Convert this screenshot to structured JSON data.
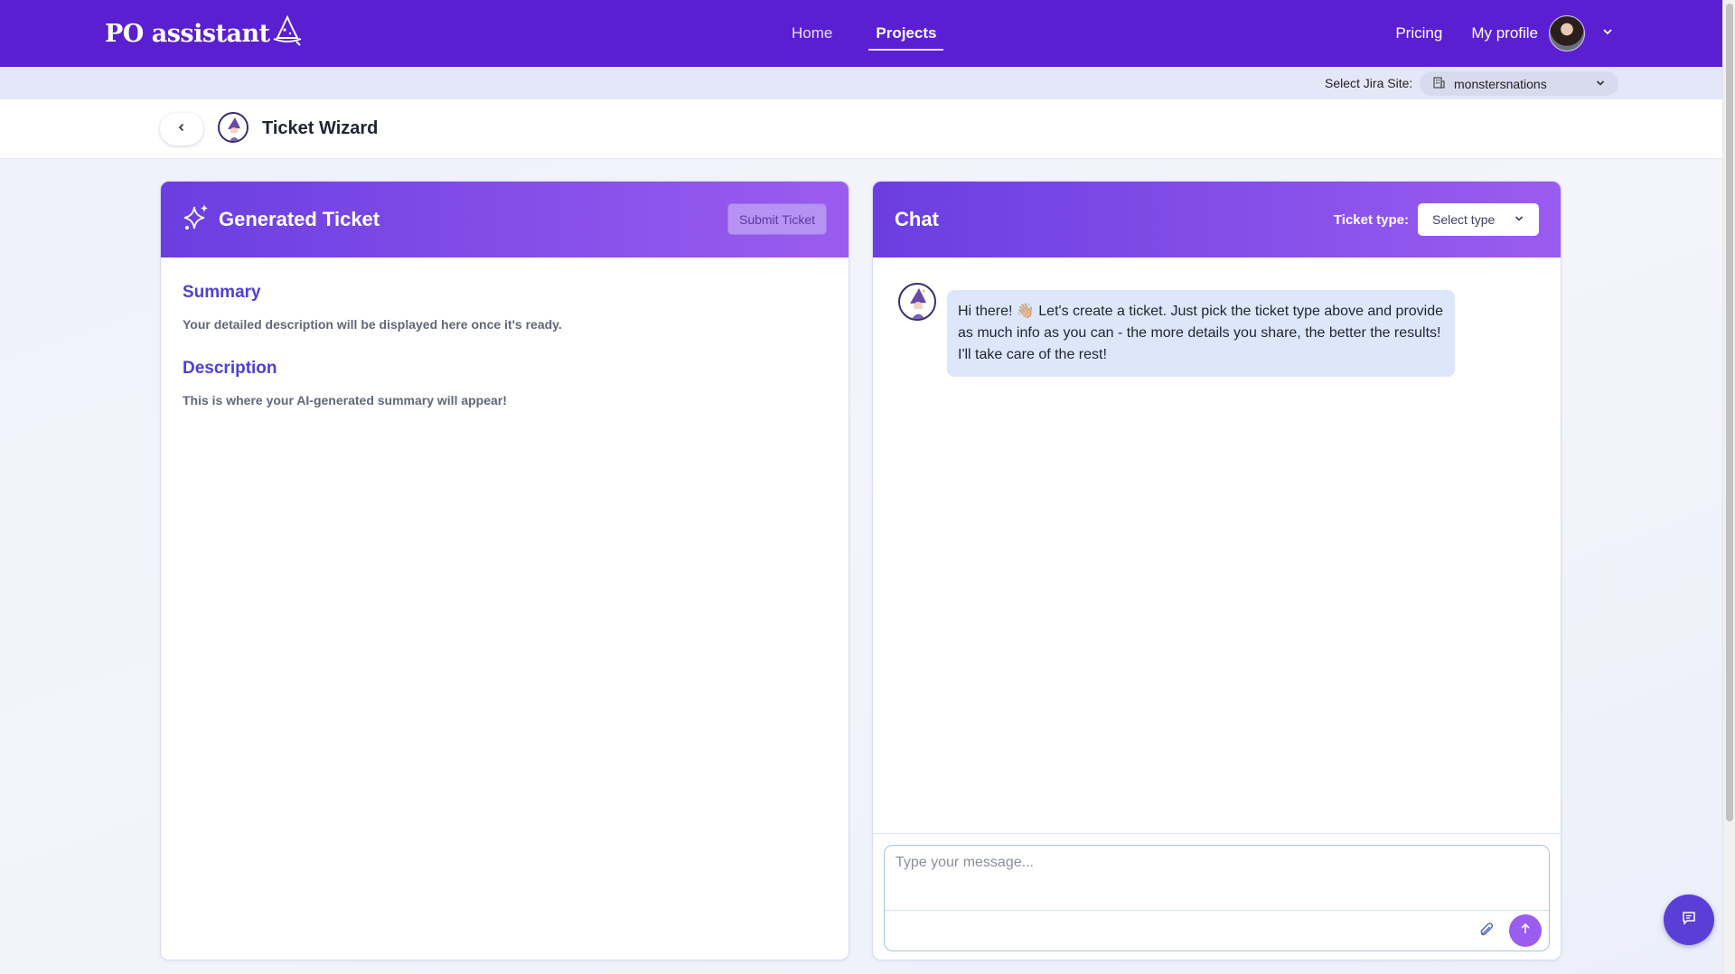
{
  "brand": {
    "logo_text": "PO assistant"
  },
  "nav": {
    "links": [
      {
        "label": "Home"
      },
      {
        "label": "Projects"
      }
    ],
    "pricing": "Pricing",
    "profile": "My profile"
  },
  "jira": {
    "label": "Select Jira Site:",
    "site": "monstersnations"
  },
  "wizard": {
    "title": "Ticket Wizard"
  },
  "generated": {
    "title": "Generated Ticket",
    "submit_label": "Submit Ticket",
    "summary_heading": "Summary",
    "summary_text": "Your detailed description will be displayed here once it's ready.",
    "description_heading": "Description",
    "description_text": "This is where your AI-generated summary will appear!"
  },
  "chat": {
    "title": "Chat",
    "ticket_type_label": "Ticket type:",
    "ticket_type_value": "Select type",
    "message": "Hi there! 👋🏼 Let's create a ticket. Just pick the ticket type above and provide as much info as you can - the more details you share, the better the results! I'll take care of the rest!",
    "input_placeholder": "Type your message..."
  },
  "colors": {
    "nav_bg": "#5a1fd1",
    "panel_gradient_start": "#6b3ee0",
    "panel_gradient_end": "#9b5cf0",
    "heading_accent": "#4d3fcf",
    "bubble_bg": "#dde7fb"
  },
  "icons": [
    "wizard-hat-icon",
    "chevron-down-icon",
    "building-icon",
    "chevron-left-icon",
    "sparkle-icon",
    "paperclip-icon",
    "arrow-up-icon",
    "chat-icon"
  ]
}
